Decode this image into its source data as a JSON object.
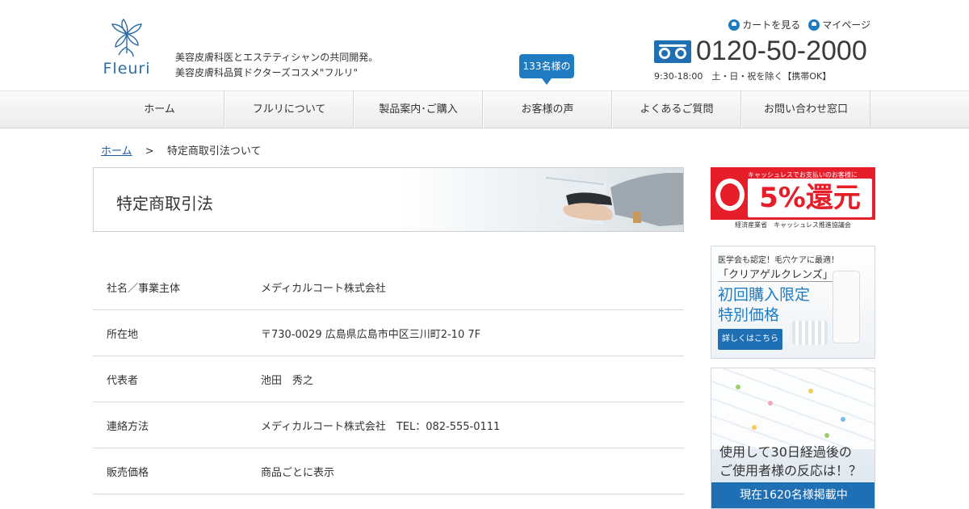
{
  "header": {
    "logo_text": "Fleuri",
    "tagline_line1": "美容皮膚科医とエステティシャンの共同開発。",
    "tagline_line2": "美容皮膚科品質ドクターズコスメ\"フルリ\"",
    "voice_badge": "133名様の",
    "links": {
      "cart": "カートを見る",
      "mypage": "マイページ"
    },
    "phone": "0120-50-2000",
    "hours": "9:30-18:00　土・日・祝を除く【携帯OK】",
    "colors": {
      "brand_blue": "#1f7cc0",
      "accent_red": "#e61e2a"
    }
  },
  "nav": {
    "items": [
      {
        "label": "ホーム"
      },
      {
        "label": "フルリについて"
      },
      {
        "label": "製品案内･ご購入"
      },
      {
        "label": "お客様の声"
      },
      {
        "label": "よくあるご質問"
      },
      {
        "label": "お問い合わせ窓口"
      }
    ]
  },
  "breadcrumb": {
    "home": "ホーム",
    "separator": ">",
    "current": "特定商取引法ついて"
  },
  "page": {
    "title": "特定商取引法"
  },
  "info_rows": [
    {
      "key": "社名／事業主体",
      "value": "メディカルコート株式会社"
    },
    {
      "key": "所在地",
      "value": "〒730-0029 広島県広島市中区三川町2-10 7F"
    },
    {
      "key": "代表者",
      "value": "池田　秀之"
    },
    {
      "key": "連絡方法",
      "value": "メディカルコート株式会社　TEL：082-555-0111"
    },
    {
      "key": "販売価格",
      "value": "商品ごとに表示"
    }
  ],
  "sidebar": {
    "cashless": {
      "top": "キャッシュレスでお支払いのお客様に",
      "big": "5%還元",
      "bottom": "経済産業省　キャッシュレス推進協議会"
    },
    "clear_gel": {
      "line1": "医学会も認定！毛穴ケアに最適！",
      "line2": "「クリアゲルクレンズ」",
      "line3a": "初回購入限定",
      "line3b": "特別価格",
      "button": "詳しくはこちら"
    },
    "voices": {
      "line1": "使用して30日経過後の",
      "line2": "ご使用者様の反応は！？",
      "footer": "現在1620名様掲載中"
    }
  }
}
